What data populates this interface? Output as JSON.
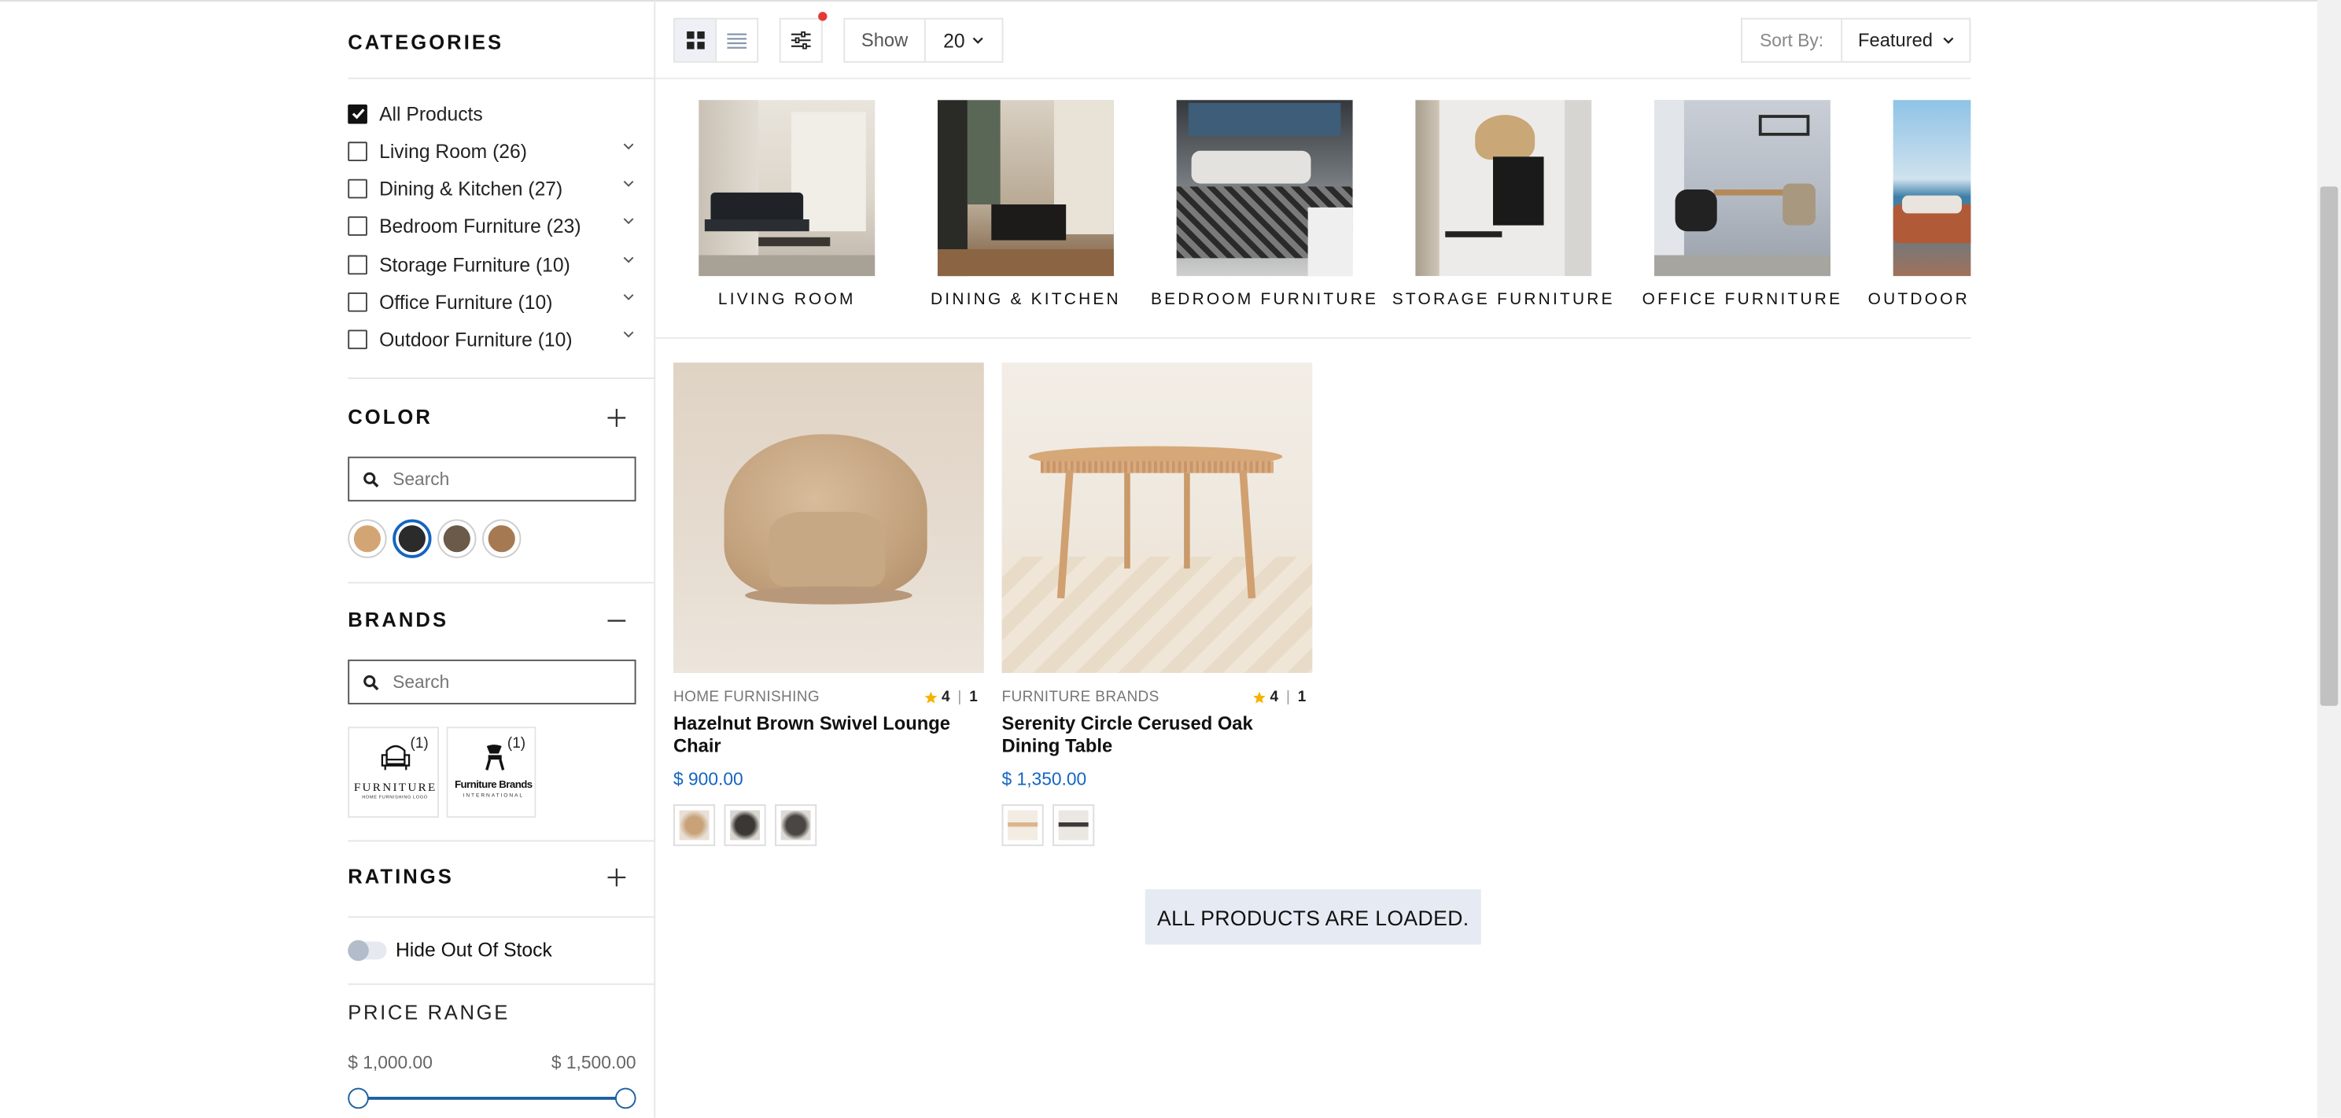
{
  "sidebar": {
    "categories_title": "CATEGORIES",
    "categories": [
      {
        "label": "All Products",
        "checked": true,
        "expandable": false
      },
      {
        "label": "Living Room (26)",
        "checked": false,
        "expandable": true
      },
      {
        "label": "Dining & Kitchen (27)",
        "checked": false,
        "expandable": true
      },
      {
        "label": "Bedroom Furniture (23)",
        "checked": false,
        "expandable": true
      },
      {
        "label": "Storage Furniture (10)",
        "checked": false,
        "expandable": true
      },
      {
        "label": "Office Furniture (10)",
        "checked": false,
        "expandable": true
      },
      {
        "label": "Outdoor Furniture (10)",
        "checked": false,
        "expandable": true
      }
    ],
    "color_title": "COLOR",
    "color_search_placeholder": "Search",
    "color_swatches": [
      "#d4a574",
      "#2b2b2b",
      "#6b5a4a",
      "#a57a52"
    ],
    "selected_swatch_index": 1,
    "brands_title": "BRANDS",
    "brands_search_placeholder": "Search",
    "brands": [
      {
        "count": "(1)",
        "name": "FURNITURE",
        "sub": "HOME FURNISHING LOGO"
      },
      {
        "count": "(1)",
        "name": "Furniture Brands",
        "sub": "INTERNATIONAL"
      }
    ],
    "ratings_title": "RATINGS",
    "hide_out_of_stock": "Hide Out Of Stock",
    "price_title": "PRICE RANGE",
    "price_min": "$ 1,000.00",
    "price_max": "$ 1,500.00"
  },
  "toolbar": {
    "show_label": "Show",
    "show_value": "20",
    "sort_label": "Sort By:",
    "sort_value": "Featured"
  },
  "category_strip": [
    "LIVING ROOM",
    "DINING & KITCHEN",
    "BEDROOM FURNITURE",
    "STORAGE FURNITURE",
    "OFFICE FURNITURE",
    "OUTDOOR FURNITURE"
  ],
  "products": [
    {
      "brand": "HOME FURNISHING",
      "rating": "4",
      "reviews": "1",
      "name": "Hazelnut Brown Swivel Lounge Chair",
      "price": "$ 900.00",
      "thumbs": [
        "#c9a27a",
        "#3a3734",
        "#4a4643"
      ]
    },
    {
      "brand": "FURNITURE BRANDS",
      "rating": "4",
      "reviews": "1",
      "name": "Serenity Circle Cerused Oak Dining Table",
      "price": "$ 1,350.00",
      "thumbs": [
        "#dcb58d",
        "#3c3a38"
      ]
    }
  ],
  "all_loaded": "ALL PRODUCTS ARE LOADED."
}
